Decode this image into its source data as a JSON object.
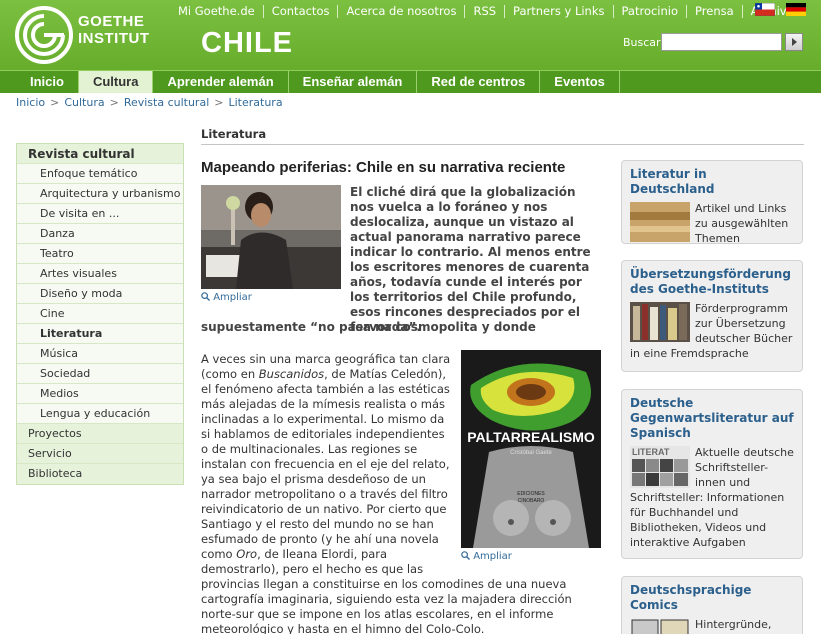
{
  "header": {
    "logo_line1": "GOETHE",
    "logo_line2": "INSTITUT",
    "country": "CHILE",
    "top_links": [
      "Mi Goethe.de",
      "Contactos",
      "Acerca de nosotros",
      "RSS",
      "Partners y Links",
      "Patrocinio",
      "Prensa",
      "Archivo"
    ],
    "search_label": "Buscar",
    "search_value": "",
    "search_placeholder": "",
    "accent_color": "#6ab42d"
  },
  "nav": {
    "items": [
      "Inicio",
      "Cultura",
      "Aprender alemán",
      "Enseñar alemán",
      "Red de centros",
      "Eventos"
    ],
    "active": "Cultura"
  },
  "breadcrumb": [
    "Inicio",
    "Cultura",
    "Revista cultural",
    "Literatura"
  ],
  "sidebar": {
    "top": "Revista cultural",
    "subitems": [
      "Enfoque temático",
      "Arquitectura y urbanismo",
      "De visita en ...",
      "Danza",
      "Teatro",
      "Artes visuales",
      "Diseño y moda",
      "Cine",
      "Literatura",
      "Música",
      "Sociedad",
      "Medios",
      "Lengua y educación"
    ],
    "active": "Literatura",
    "main_items": [
      "Proyectos",
      "Servicio",
      "Biblioteca"
    ]
  },
  "article": {
    "section": "Literatura",
    "title": "Mapeando periferias: Chile en su narrativa reciente",
    "ampliar": "Ampliar",
    "intro": "El cliché dirá que la globalización nos vuelca a lo foráneo y nos deslocaliza, aunque un vistazo al actual panorama narrativo parece indicar lo contrario. Al menos entre los escritores menores de cuarenta años, todavía cunde el interés por los territorios del Chile profundo, esos rincones despreciados por el fervor cosmopolita y donde",
    "intro_tail": "supuestamente “no pasa nada”.",
    "p1_a": "A veces sin una marca geográfica tan clara (como en ",
    "p1_em1": "Buscanidos",
    "p1_b": ", de Matías Celedón), el fenómeno afecta también a las estéticas más alejadas de la mímesis realista o más inclinadas a lo experimental. Lo mismo da si hablamos de editoriales independientes o de multinacionales. Las regiones se instalan con frecuencia en el eje del relato, ya sea bajo el prisma desdeñoso de un narrador metropolitano o a través del filtro reivindicatorio de un nativo. Por cierto que Santiago y el resto del mundo no se han esfumado de pronto (y he ahí una novela como ",
    "p1_em2": "Oro",
    "p1_c": ", de Ileana Elordi, para demostrarlo), pero el hecho es que las",
    "p1_wide": "provincias llegan a constituirse en los comodines de una nueva cartografía imaginaria, siguiendo esta vez la majadera dirección norte-sur que se impone en los atlas escolares, en el informe meteorológico y hasta en el himno del Colo-Colo.",
    "book": {
      "title": "PALTARREALISMO",
      "author": "Cristóbal Gaete",
      "publisher_line1": "EDICIONES",
      "publisher_line2": "CINOBARO"
    }
  },
  "right_boxes": [
    {
      "title": "Literatur in Deutschland",
      "body": "Artikel und Links zu ausgewählten Themen"
    },
    {
      "title": "Übersetzungsförderung des Goethe-Instituts",
      "body": "Förderprogramm zur Übersetzung deutscher Bücher in eine Fremdsprache"
    },
    {
      "title": "Deutsche Gegenwartsliteratur auf Spanisch",
      "body": "Aktuelle deutsche Schriftsteller-innen und Schriftsteller: Informationen für Buchhandel und Bibliotheken, Videos und interaktive Aufgaben",
      "thumb_label": "LITERAT"
    },
    {
      "title": "Deutschsprachige Comics",
      "body": "Hintergründe, Künstlerporträts"
    }
  ]
}
